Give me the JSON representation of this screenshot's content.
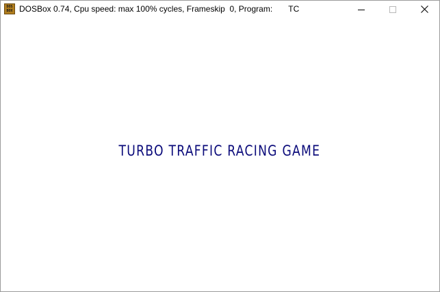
{
  "window": {
    "title": "DOSBox 0.74, Cpu speed: max 100% cycles, Frameskip  0, Program:       TC",
    "app_icon_text": "DOS BOX",
    "controls": {
      "minimize_icon": "minimize-icon",
      "maximize_icon": "maximize-icon",
      "close_icon": "close-icon"
    }
  },
  "screen": {
    "game_title": "TURBO TRAFFIC RACING GAME",
    "text_color": "#0a0a7a",
    "background_color": "#ffffff"
  }
}
